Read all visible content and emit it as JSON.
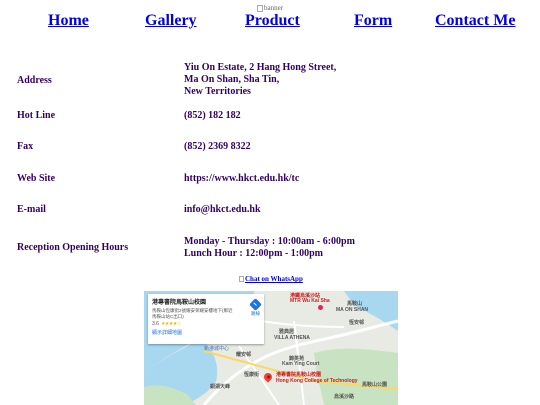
{
  "banner": {
    "alt": "banner"
  },
  "nav": {
    "items": [
      "Home",
      "Gallery",
      "Product",
      "Form",
      "Contact Me"
    ]
  },
  "contact": {
    "rows": [
      {
        "label": "Address",
        "lines": [
          "Yiu On Estate, 2 Hang Hong Street,",
          "Ma On Shan, Sha Tin,",
          "New Territories"
        ]
      },
      {
        "label": "Hot Line",
        "lines": [
          "(852) 182 182"
        ]
      },
      {
        "label": "Fax",
        "lines": [
          "(852) 2369 8322"
        ]
      },
      {
        "label": "Web Site",
        "lines": [
          "https://www.hkct.edu.hk/tc"
        ]
      },
      {
        "label": "E-mail",
        "lines": [
          "info@hkct.edu.hk"
        ]
      },
      {
        "label": "Reception Opening Hours",
        "lines": [
          "Monday - Thursday : 10:00am - 6:00pm",
          "Lunch Hour : 12:00pm - 1:00pm"
        ]
      }
    ]
  },
  "whatsapp": {
    "alt": "Chat on WhatsApp"
  },
  "map": {
    "card": {
      "title": "港專書院馬鞍山校園",
      "address": "馬鞍山恆康街2號耀安邨耀安樓地下(鄰近馬鞍山站C出口)",
      "rating": "3.6",
      "stars": "★★★★☆",
      "bigger_map": "顯示詳細地圖",
      "directions": "路線"
    },
    "labels": {
      "ma_on_shan_cn": "馬鞍山",
      "ma_on_shan_en": "MA ON SHAN",
      "villa_athena_cn": "雅典居",
      "villa_athena_en": "VILLA ATHENA",
      "college_cn": "港專書院馬鞍山校園",
      "college_en": "Hong Kong College of Technology",
      "top_poi_cn": "港鐵烏溪沙站",
      "top_poi_en": "MTR Wu Kai Sha",
      "yiu_on": "耀安邨",
      "hang_on": "恆安邨",
      "mos_plaza": "新港城中心",
      "hang_hong": "恆康街",
      "sunshine": "銀湖天峰",
      "ma_on_shan_park": "馬鞍山公園",
      "wu_kai_sha_road": "烏溪沙路",
      "kam_ying": "錦英苑",
      "kam_ying_court": "Kam Ying Court"
    },
    "colors": {
      "water": "#a8d7f0",
      "land": "#e8eae4",
      "green": "#c7e3c1",
      "road": "#ffffff",
      "pin": "#ea4335"
    }
  }
}
